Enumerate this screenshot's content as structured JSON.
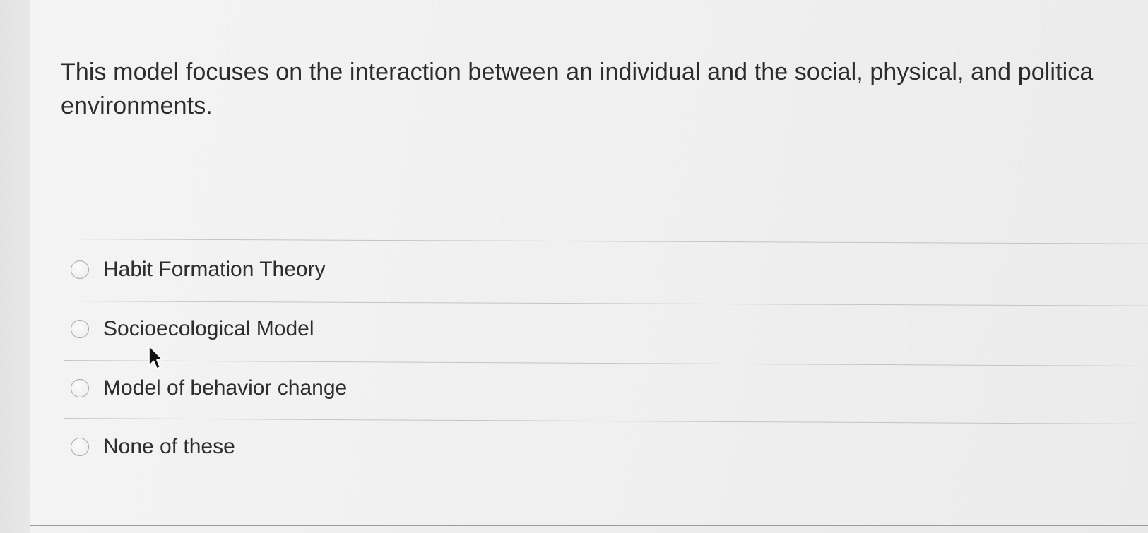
{
  "question": {
    "line1": "This model focuses on the interaction between an individual and the social, physical, and politica",
    "line2": "environments."
  },
  "options": [
    {
      "label": "Habit Formation Theory",
      "selected": false
    },
    {
      "label": "Socioecological Model",
      "selected": false
    },
    {
      "label": "Model of behavior change",
      "selected": false
    },
    {
      "label": "None of these",
      "selected": false
    }
  ],
  "icons": {
    "pointer": "mouse-pointer-icon",
    "radio": "radio-unselected-icon"
  }
}
